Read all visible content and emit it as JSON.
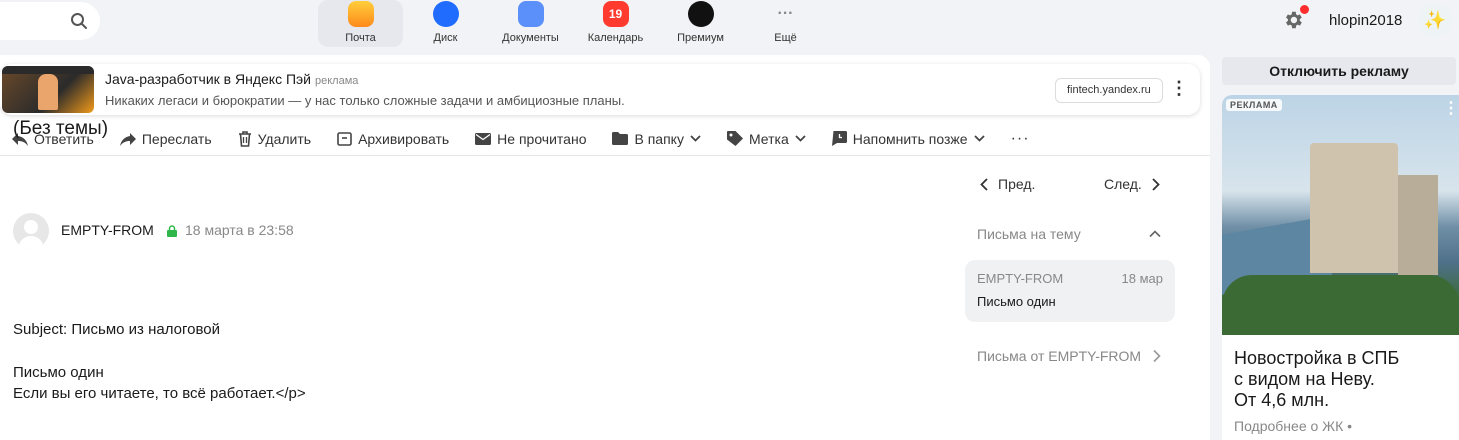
{
  "nav": {
    "apps": [
      {
        "label": "Почта",
        "icon": "mail-icon",
        "active": true
      },
      {
        "label": "Диск",
        "icon": "disk-icon"
      },
      {
        "label": "Документы",
        "icon": "documents-icon"
      },
      {
        "label": "Календарь",
        "icon": "calendar-icon",
        "badge": "19"
      },
      {
        "label": "Премиум",
        "icon": "premium-icon"
      },
      {
        "label": "Ещё",
        "icon": "more-dots-icon",
        "glyph": "···"
      }
    ],
    "username": "hlopin2018"
  },
  "ad_banner": {
    "title": "Java-разработчик в Яндекс Пэй",
    "tag": "реклама",
    "description": "Никаких легаси и бюрократии — у нас только сложные задачи и амбициозные планы.",
    "domain": "fintech.yandex.ru",
    "menu_glyph": "⋮"
  },
  "toolbar": {
    "reply": "Ответить",
    "forward": "Переслать",
    "delete": "Удалить",
    "archive": "Архивировать",
    "unread": "Не прочитано",
    "to_folder": "В папку",
    "label": "Метка",
    "remind": "Напомнить позже",
    "more": "···"
  },
  "message": {
    "subject": "(Без темы)",
    "sender": "EMPTY-FROM",
    "date": "18 марта в 23:58",
    "body": [
      "Subject: Письмо из налоговой",
      "Письмо один",
      "Если вы его читаете, то всё работает.</p>"
    ]
  },
  "pager": {
    "prev": "Пред.",
    "next": "След."
  },
  "thread": {
    "title": "Письма на тему",
    "items": [
      {
        "from": "EMPTY-FROM",
        "date": "18 мар",
        "subject": "Письмо один"
      }
    ],
    "from_link": "Письма от EMPTY-FROM"
  },
  "side_ad": {
    "disable_label": "Отключить рекламу",
    "tag": "РЕКЛАМА",
    "menu_glyph": "⋮",
    "headline_lines": [
      "Новостройка в СПБ",
      "с видом на Неву.",
      "От 4,6 млн."
    ],
    "more": "Подробнее о ЖК •"
  }
}
